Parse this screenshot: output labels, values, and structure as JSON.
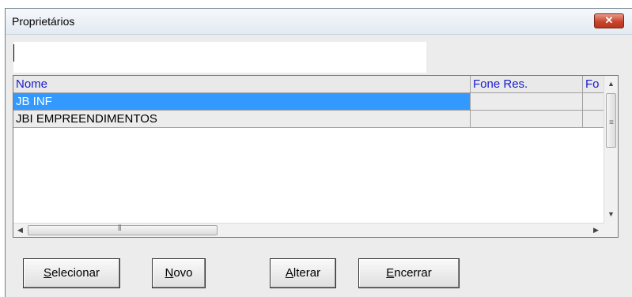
{
  "window": {
    "title": "Proprietários",
    "close_label": "✕"
  },
  "search": {
    "value": "",
    "placeholder": ""
  },
  "table": {
    "columns": [
      "Nome",
      "Fone Res.",
      "Fo"
    ],
    "rows": [
      {
        "name": "JB INF",
        "fone_res": "",
        "fo": "",
        "selected": true
      },
      {
        "name": "JBI EMPREENDIMENTOS",
        "fone_res": "",
        "fo": "",
        "selected": false
      }
    ]
  },
  "buttons": {
    "selecionar": {
      "accel": "S",
      "rest": "elecionar"
    },
    "novo": {
      "accel": "N",
      "rest": "ovo"
    },
    "alterar": {
      "accel": "A",
      "rest": "lterar"
    },
    "encerrar": {
      "accel": "E",
      "rest": "ncerrar"
    }
  },
  "colors": {
    "selection": "#3399ff",
    "header_text": "#1a1ad0",
    "close": "#c9452d"
  }
}
